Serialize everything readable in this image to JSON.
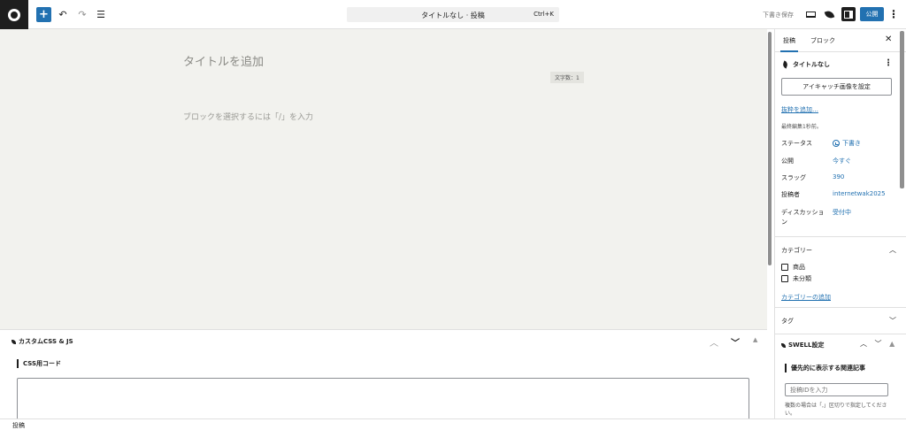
{
  "toolbar": {
    "add_label": "+",
    "undo_label": "↶",
    "redo_label": "↷",
    "list_view_label": "☰",
    "command_title": "タイトルなし · 投稿",
    "command_shortcut": "Ctrl+K",
    "save_draft_label": "下書き保存",
    "publish_label": "公開",
    "options_label": "⋮"
  },
  "editor": {
    "title_placeholder": "タイトルを追加",
    "char_count": "文字数：1",
    "block_placeholder": "ブロックを選択するには「/」を入力"
  },
  "metabox": {
    "title": "カスタムCSS & JS",
    "up_label": "︿",
    "down_label": "﹀",
    "toggle_label": "▲",
    "css_label": "CSS用コード"
  },
  "statusbar": {
    "breadcrumb": "投稿"
  },
  "sidebar": {
    "tabs": [
      {
        "label": "投稿"
      },
      {
        "label": "ブロック"
      }
    ],
    "close_label": "✕",
    "post_title": "タイトルなし",
    "more_label": "⋮",
    "featured_image_label": "アイキャッチ画像を設定",
    "excerpt_link": "抜粋を追加…",
    "last_edited": "最終編集1秒前。",
    "meta": [
      {
        "key": "ステータス",
        "value": "下書き"
      },
      {
        "key": "公開",
        "value": "今すぐ"
      },
      {
        "key": "スラッグ",
        "value": "390"
      },
      {
        "key": "投稿者",
        "value": "internetwak2025"
      },
      {
        "key": "ディスカッション",
        "value": "受付中"
      }
    ],
    "categories_title": "カテゴリー",
    "categories_chevron": "︿",
    "categories": [
      {
        "label": "商品"
      },
      {
        "label": "未分類"
      }
    ],
    "add_category_link": "カテゴリーの追加",
    "tags_title": "タグ",
    "tags_chevron": "﹀",
    "swell_title": "SWELL設定",
    "swell_controls": {
      "up": "︿",
      "down": "﹀",
      "toggle": "▲"
    },
    "related_label": "優先的に表示する関連記事",
    "related_placeholder": "投稿IDを入力",
    "related_help": "複数の場合は「,」区切りで指定してください。"
  },
  "colors": {
    "accent": "#2271b1",
    "canvas_bg": "#f2f2ee",
    "dark": "#1e1e1e"
  },
  "icons": {
    "site": "wordpress-site-icon",
    "preview": "desktop-preview-icon",
    "swell": "swell-leaf-icon",
    "settings": "sidebar-settings-icon",
    "post_type": "feather-post-icon",
    "scheduled": "clock-icon"
  }
}
